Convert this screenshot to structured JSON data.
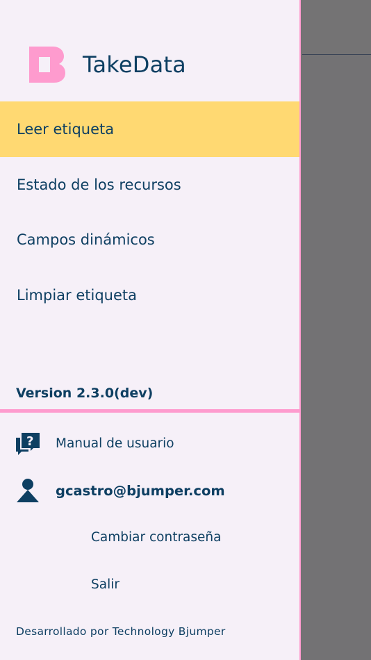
{
  "brand": {
    "name": "TakeData",
    "accent": "#fe9bce",
    "text_color": "#0e3f62",
    "active_bg": "#ffd972"
  },
  "menu": {
    "items": [
      {
        "label": "Leer etiqueta",
        "active": true
      },
      {
        "label": "Estado de los recursos",
        "active": false
      },
      {
        "label": "Campos dinámicos",
        "active": false
      },
      {
        "label": "Limpiar etiqueta",
        "active": false
      }
    ]
  },
  "version": "Version 2.3.0(dev)",
  "help": {
    "icon": "question-chat-icon",
    "label": "Manual de usuario"
  },
  "user": {
    "icon": "user-icon",
    "email": "gcastro@bjumper.com",
    "change_password": "Cambiar contraseña",
    "logout": "Salir"
  },
  "footer": "Desarrollado por Technology Bjumper"
}
